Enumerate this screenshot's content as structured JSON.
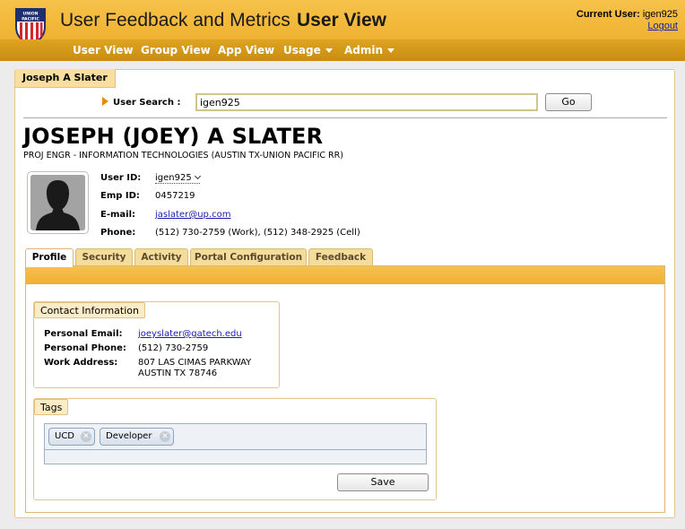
{
  "header": {
    "app_title": "User Feedback and Metrics",
    "view_title": "User View",
    "logo_top_text": "UNION",
    "logo_bottom_text": "PACIFIC",
    "current_user_label": "Current User:",
    "current_user": "igen925",
    "logout": "Logout"
  },
  "nav": {
    "items": [
      {
        "label": "User View"
      },
      {
        "label": "Group View"
      },
      {
        "label": "App View"
      },
      {
        "label": "Usage",
        "dropdown": true
      },
      {
        "label": "Admin",
        "dropdown": true
      }
    ]
  },
  "panel": {
    "title": "Joseph A Slater"
  },
  "search": {
    "label": "User Search :",
    "value": "igen925",
    "go_label": "Go"
  },
  "person": {
    "name": "JOSEPH (JOEY) A SLATER",
    "title": "PROJ ENGR - INFORMATION TECHNOLOGIES (AUSTIN TX-UNION PACIFIC RR)",
    "user_id_label": "User ID:",
    "user_id": "igen925",
    "emp_id_label": "Emp ID:",
    "emp_id": "0457219",
    "email_label": "E-mail:",
    "email": "jaslater@up.com",
    "phone_label": "Phone:",
    "phone": "(512) 730-2759 (Work), (512) 348-2925 (Cell)"
  },
  "tabs": [
    {
      "label": "Profile",
      "active": true
    },
    {
      "label": "Security"
    },
    {
      "label": "Activity"
    },
    {
      "label": "Portal Configuration"
    },
    {
      "label": "Feedback"
    }
  ],
  "contact": {
    "title": "Contact Information",
    "personal_email_label": "Personal Email:",
    "personal_email": "joeyslater@gatech.edu",
    "personal_phone_label": "Personal Phone:",
    "personal_phone": "(512) 730-2759",
    "work_address_label": "Work Address:",
    "work_address_line1": "807 LAS CIMAS PARKWAY",
    "work_address_line2": "AUSTIN TX 78746"
  },
  "tags": {
    "title": "Tags",
    "items": [
      {
        "label": "UCD"
      },
      {
        "label": "Developer"
      }
    ],
    "save_label": "Save"
  },
  "colors": {
    "banner": "#f0b231",
    "navbar": "#d39a18",
    "link": "#1b1bb0"
  }
}
